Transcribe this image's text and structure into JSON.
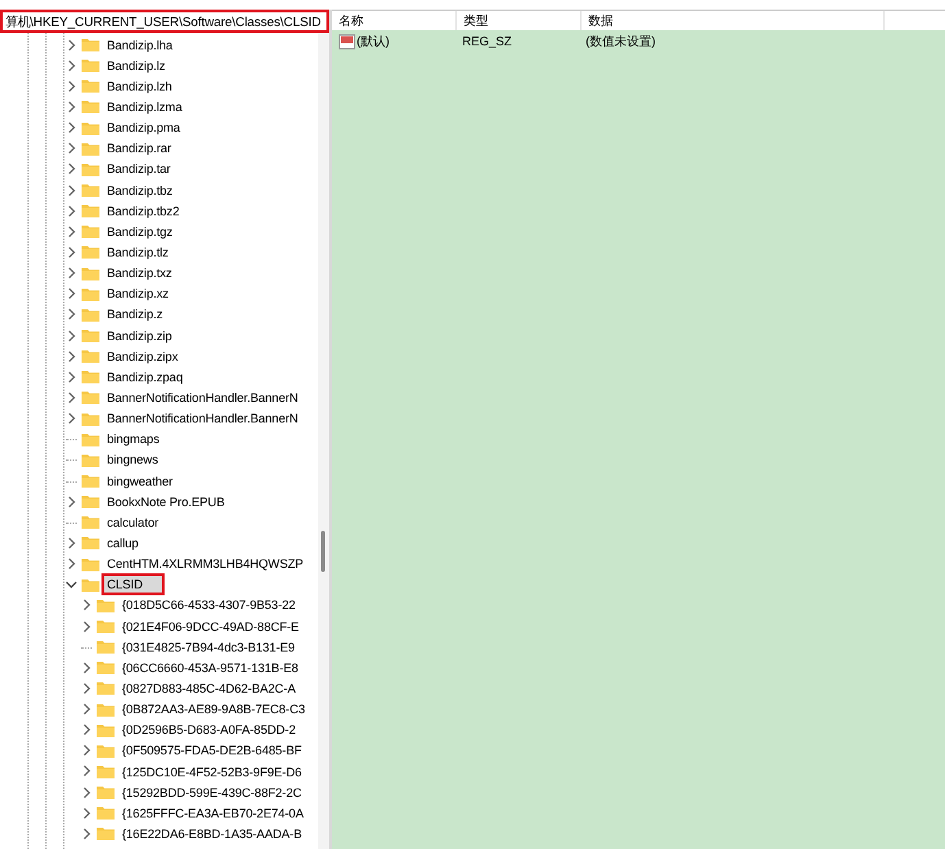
{
  "address_bar": {
    "path": "算机\\HKEY_CURRENT_USER\\Software\\Classes\\CLSID",
    "highlighted": true
  },
  "tree": {
    "items": [
      {
        "name": "Bandizip.lha",
        "expandable": true,
        "expanded": false,
        "selected": false
      },
      {
        "name": "Bandizip.lz",
        "expandable": true,
        "expanded": false,
        "selected": false
      },
      {
        "name": "Bandizip.lzh",
        "expandable": true,
        "expanded": false,
        "selected": false
      },
      {
        "name": "Bandizip.lzma",
        "expandable": true,
        "expanded": false,
        "selected": false
      },
      {
        "name": "Bandizip.pma",
        "expandable": true,
        "expanded": false,
        "selected": false
      },
      {
        "name": "Bandizip.rar",
        "expandable": true,
        "expanded": false,
        "selected": false
      },
      {
        "name": "Bandizip.tar",
        "expandable": true,
        "expanded": false,
        "selected": false
      },
      {
        "name": "Bandizip.tbz",
        "expandable": true,
        "expanded": false,
        "selected": false
      },
      {
        "name": "Bandizip.tbz2",
        "expandable": true,
        "expanded": false,
        "selected": false
      },
      {
        "name": "Bandizip.tgz",
        "expandable": true,
        "expanded": false,
        "selected": false
      },
      {
        "name": "Bandizip.tlz",
        "expandable": true,
        "expanded": false,
        "selected": false
      },
      {
        "name": "Bandizip.txz",
        "expandable": true,
        "expanded": false,
        "selected": false
      },
      {
        "name": "Bandizip.xz",
        "expandable": true,
        "expanded": false,
        "selected": false
      },
      {
        "name": "Bandizip.z",
        "expandable": true,
        "expanded": false,
        "selected": false
      },
      {
        "name": "Bandizip.zip",
        "expandable": true,
        "expanded": false,
        "selected": false
      },
      {
        "name": "Bandizip.zipx",
        "expandable": true,
        "expanded": false,
        "selected": false
      },
      {
        "name": "Bandizip.zpaq",
        "expandable": true,
        "expanded": false,
        "selected": false
      },
      {
        "name": "BannerNotificationHandler.BannerN",
        "expandable": true,
        "expanded": false,
        "selected": false
      },
      {
        "name": "BannerNotificationHandler.BannerN",
        "expandable": true,
        "expanded": false,
        "selected": false
      },
      {
        "name": "bingmaps",
        "expandable": false,
        "expanded": false,
        "selected": false
      },
      {
        "name": "bingnews",
        "expandable": false,
        "expanded": false,
        "selected": false
      },
      {
        "name": "bingweather",
        "expandable": false,
        "expanded": false,
        "selected": false
      },
      {
        "name": "BookxNote Pro.EPUB",
        "expandable": true,
        "expanded": false,
        "selected": false
      },
      {
        "name": "calculator",
        "expandable": false,
        "expanded": false,
        "selected": false
      },
      {
        "name": "callup",
        "expandable": true,
        "expanded": false,
        "selected": false
      },
      {
        "name": "CentHTM.4XLRMM3LHB4HQWSZP",
        "expandable": true,
        "expanded": false,
        "selected": false
      },
      {
        "name": "CLSID",
        "expandable": true,
        "expanded": true,
        "selected": true,
        "highlighted": true,
        "children": [
          {
            "name": "{018D5C66-4533-4307-9B53-22",
            "expandable": true,
            "expanded": false,
            "selected": false
          },
          {
            "name": "{021E4F06-9DCC-49AD-88CF-E",
            "expandable": true,
            "expanded": false,
            "selected": false
          },
          {
            "name": "{031E4825-7B94-4dc3-B131-E9",
            "expandable": false,
            "expanded": false,
            "selected": false
          },
          {
            "name": "{06CC6660-453A-9571-131B-E8",
            "expandable": true,
            "expanded": false,
            "selected": false
          },
          {
            "name": "{0827D883-485C-4D62-BA2C-A",
            "expandable": true,
            "expanded": false,
            "selected": false
          },
          {
            "name": "{0B872AA3-AE89-9A8B-7EC8-C3",
            "expandable": true,
            "expanded": false,
            "selected": false
          },
          {
            "name": "{0D2596B5-D683-A0FA-85DD-2",
            "expandable": true,
            "expanded": false,
            "selected": false
          },
          {
            "name": "{0F509575-FDA5-DE2B-6485-BF",
            "expandable": true,
            "expanded": false,
            "selected": false
          },
          {
            "name": "{125DC10E-4F52-52B3-9F9E-D6",
            "expandable": true,
            "expanded": false,
            "selected": false
          },
          {
            "name": "{15292BDD-599E-439C-88F2-2C",
            "expandable": true,
            "expanded": false,
            "selected": false
          },
          {
            "name": "{1625FFFC-EA3A-EB70-2E74-0A",
            "expandable": true,
            "expanded": false,
            "selected": false
          },
          {
            "name": "{16E22DA6-E8BD-1A35-AADA-B",
            "expandable": true,
            "expanded": false,
            "selected": false
          }
        ]
      }
    ]
  },
  "values": {
    "columns": [
      "名称",
      "类型",
      "数据"
    ],
    "rows": [
      {
        "name": "(默认)",
        "type": "REG_SZ",
        "data": "(数值未设置)",
        "kind": "string"
      }
    ]
  }
}
